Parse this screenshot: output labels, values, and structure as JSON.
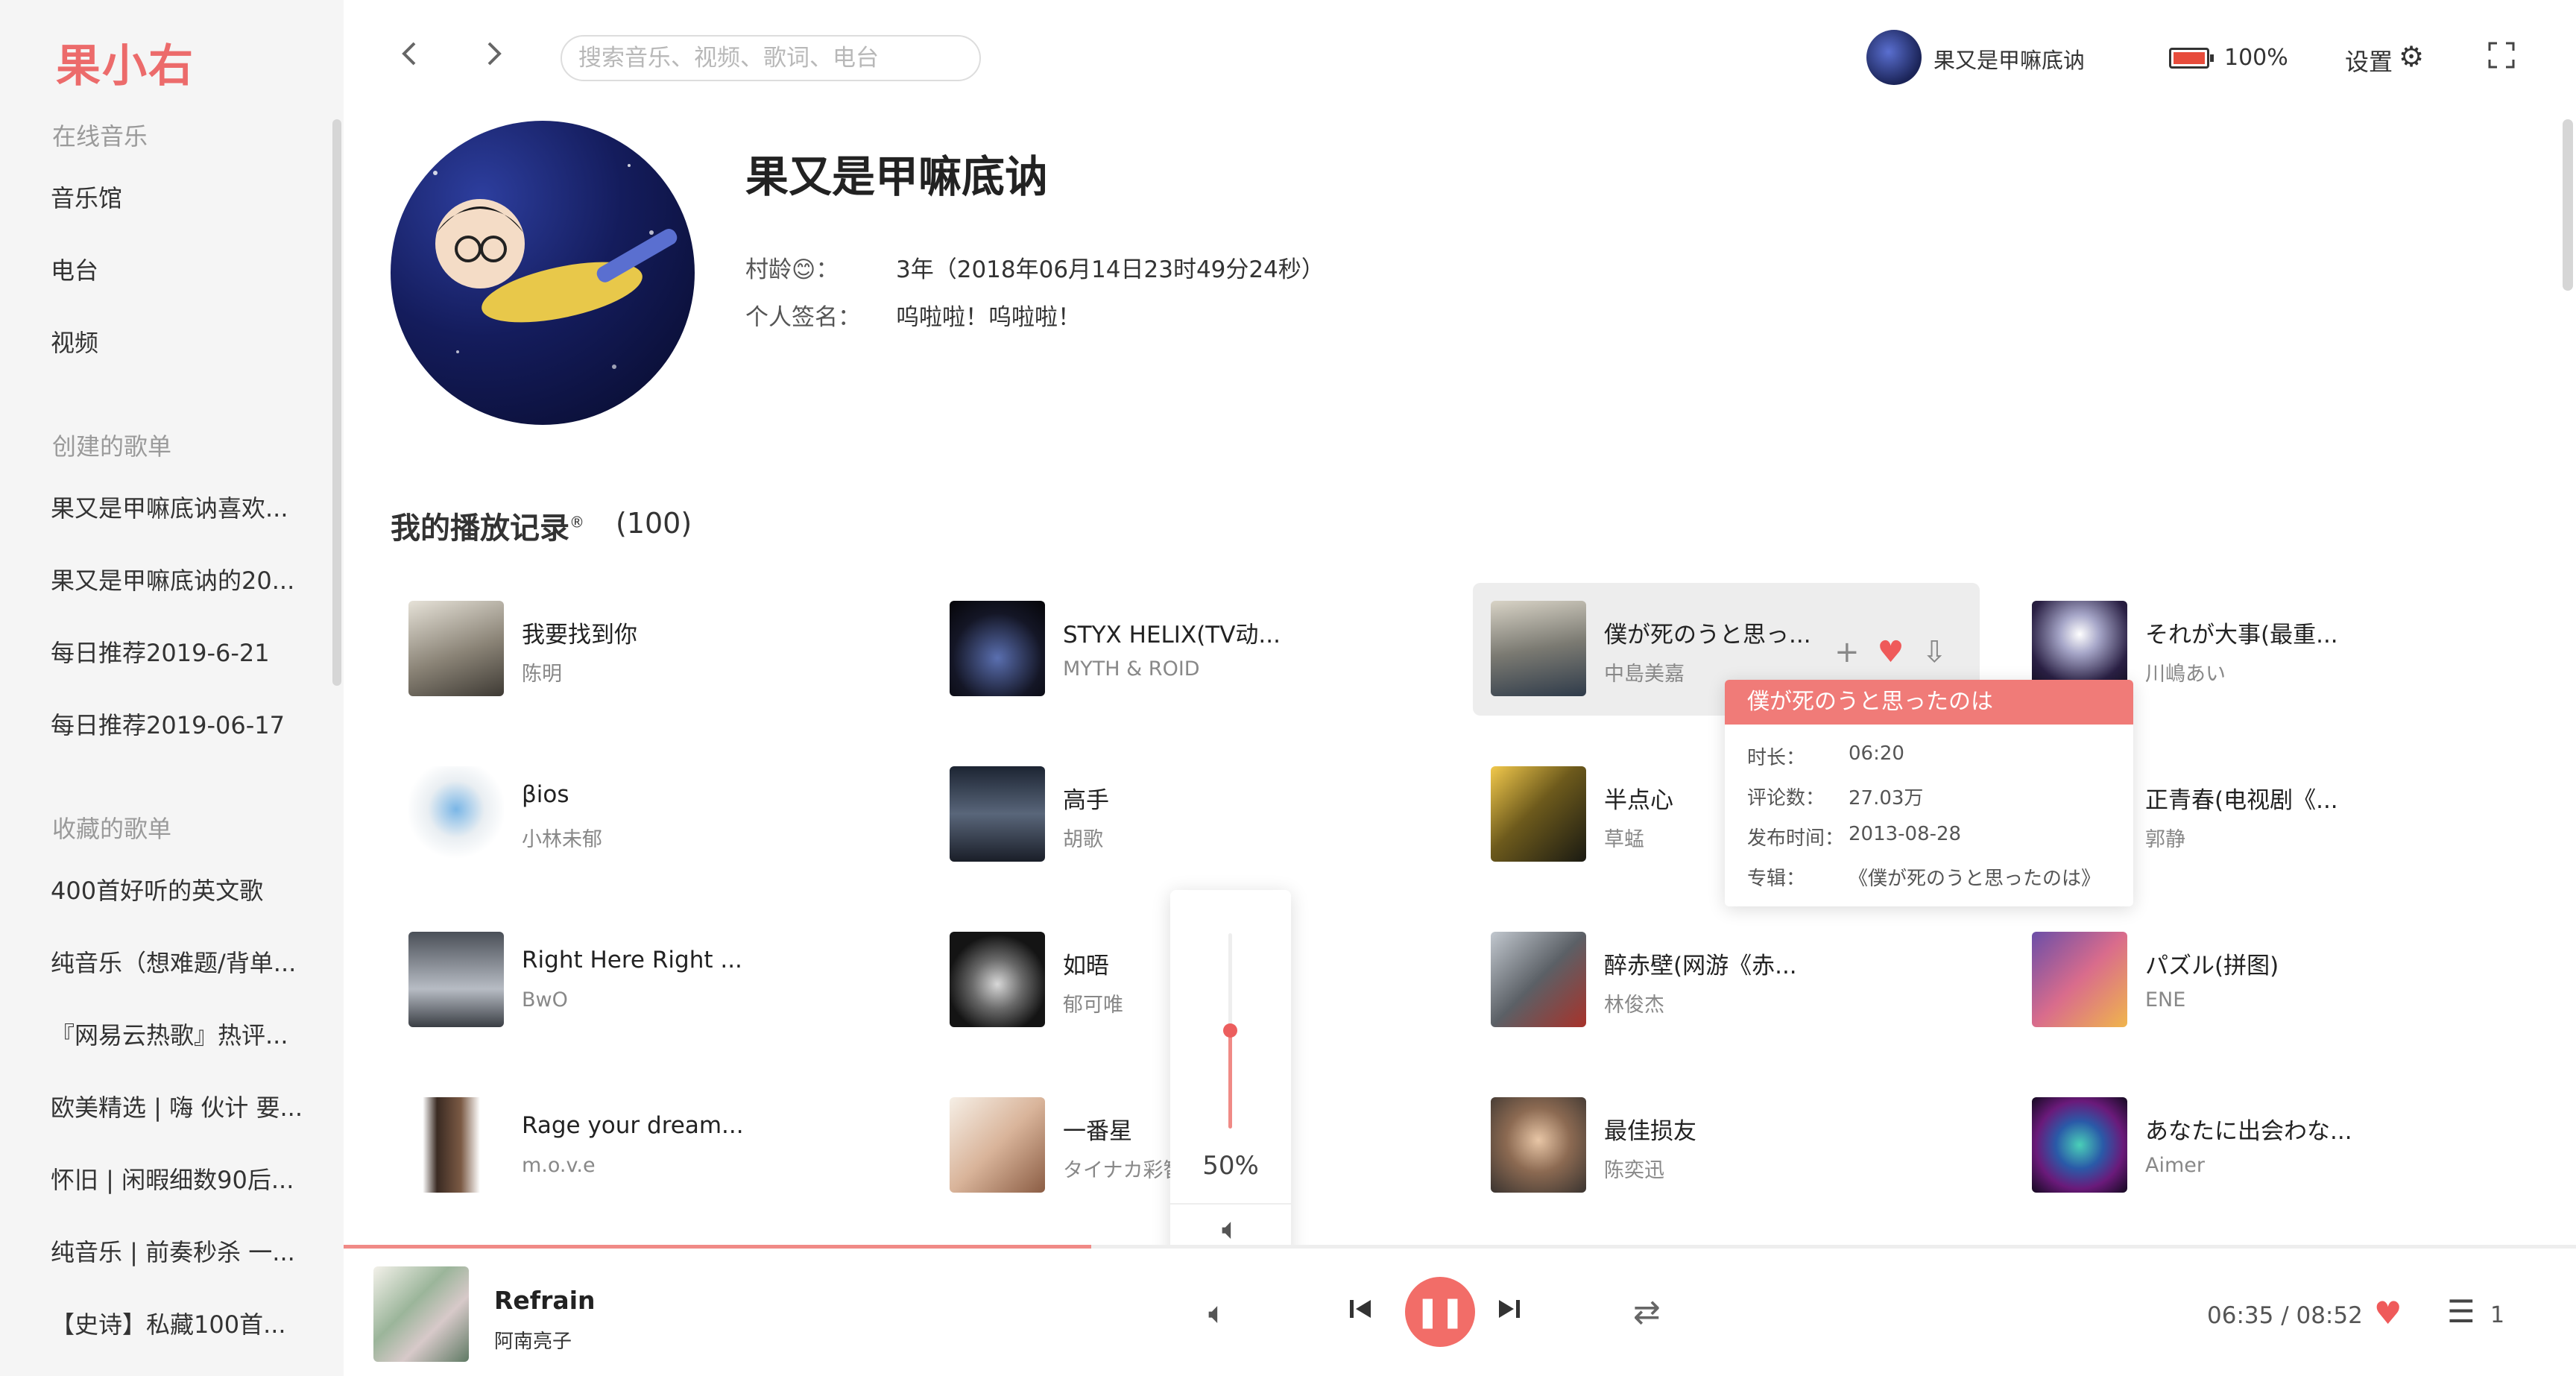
{
  "app": {
    "logo": "果小右"
  },
  "sidebar": {
    "online_heading": "在线音乐",
    "online_items": [
      {
        "label": "音乐馆"
      },
      {
        "label": "电台"
      },
      {
        "label": "视频"
      }
    ],
    "created_heading": "创建的歌单",
    "created_items": [
      {
        "label": "果又是甲嘛底讷喜欢..."
      },
      {
        "label": "果又是甲嘛底讷的20..."
      },
      {
        "label": "每日推荐2019-6-21"
      },
      {
        "label": "每日推荐2019-06-17"
      }
    ],
    "collected_heading": "收藏的歌单",
    "collected_items": [
      {
        "label": "400首好听的英文歌"
      },
      {
        "label": "纯音乐（想难题/背单..."
      },
      {
        "label": "『网易云热歌』热评..."
      },
      {
        "label": "欧美精选 | 嗨 伙计 要..."
      },
      {
        "label": "怀旧 | 闲暇细数90后..."
      },
      {
        "label": "纯音乐 | 前奏秒杀 一..."
      },
      {
        "label": "【史诗】私藏100首..."
      }
    ]
  },
  "topbar": {
    "back_icon": "chevron-left-icon",
    "forward_icon": "chevron-right-icon",
    "search_placeholder": "搜索音乐、视频、歌词、电台",
    "user_name": "果又是甲嘛底讷",
    "battery_text": "100%",
    "settings_label": "设置"
  },
  "profile": {
    "name": "果又是甲嘛底讷",
    "age_label": "村龄😊：",
    "age_value": "3年（2018年06月14日23时49分24秒）",
    "signature_label": "个人签名：",
    "signature_value": "呜啦啦！呜啦啦！"
  },
  "history": {
    "title": "我的播放记录",
    "registered_mark": "®",
    "count": "(100)",
    "songs": [
      {
        "title": "我要找到你",
        "artist": "陈明"
      },
      {
        "title": "STYX HELIX(TV动...",
        "artist": "MYTH & ROID"
      },
      {
        "title": "僕が死のうと思っ...",
        "artist": "中島美嘉"
      },
      {
        "title": "それが大事(最重...",
        "artist": "川嶋あい"
      },
      {
        "title": "βios",
        "artist": "小林未郁"
      },
      {
        "title": "高手",
        "artist": "胡歌"
      },
      {
        "title": "半点心",
        "artist": "草蜢"
      },
      {
        "title": "正青春(电视剧《...",
        "artist": "郭静"
      },
      {
        "title": "Right Here Right ...",
        "artist": "BwO"
      },
      {
        "title": "如晤",
        "artist": "郁可唯"
      },
      {
        "title": "醉赤壁(网游《赤...",
        "artist": "林俊杰"
      },
      {
        "title": "パズル(拼图)",
        "artist": "ENE"
      },
      {
        "title": "Rage your dream...",
        "artist": "m.o.v.e"
      },
      {
        "title": "一番星",
        "artist": "タイナカ彩智"
      },
      {
        "title": "最佳损友",
        "artist": "陈奕迅"
      },
      {
        "title": "あなたに出会わな...",
        "artist": "Aimer"
      }
    ]
  },
  "tooltip": {
    "title": "僕が死のうと思ったのは",
    "duration_label": "时长：",
    "duration_value": "06:20",
    "comments_label": "评论数：",
    "comments_value": "27.03万",
    "release_label": "发布时间：",
    "release_value": "2013-08-28",
    "album_label": "专辑：",
    "album_value": "《僕が死のうと思ったのは》"
  },
  "volume": {
    "level": 0.5,
    "text": "50%"
  },
  "player": {
    "title": "Refrain",
    "artist": "阿南亮子",
    "time": "06:35 / 08:52",
    "progress": 0.335,
    "playlist_count": "1"
  },
  "colors": {
    "accent": "#f26d68",
    "heart": "#ef5a5a",
    "sidebar_bg": "#f5f5f5"
  }
}
